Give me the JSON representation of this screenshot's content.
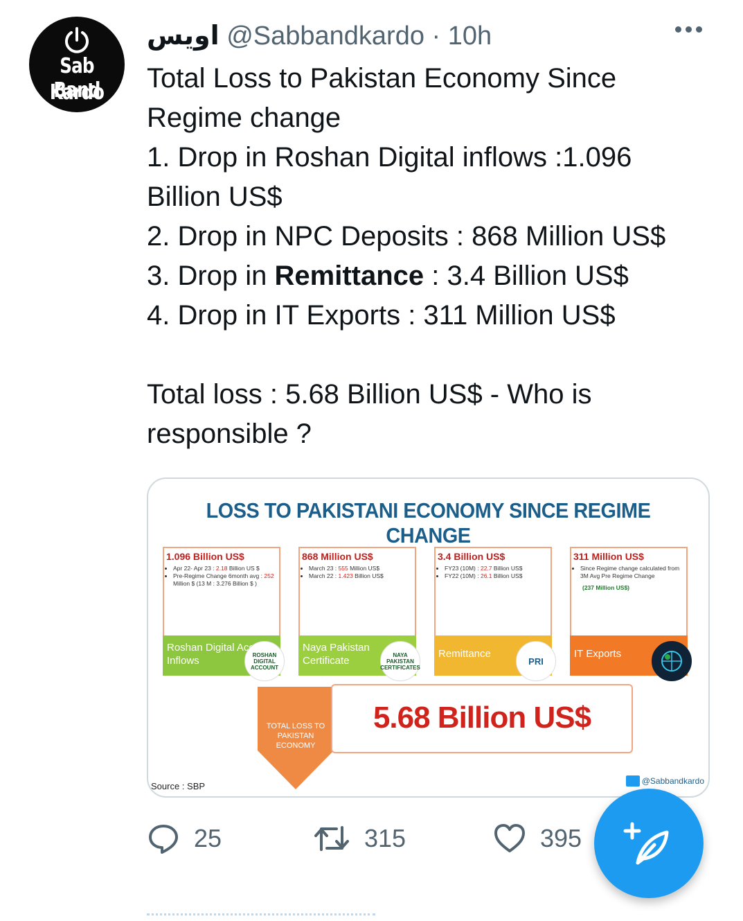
{
  "avatar": {
    "line1": "Sab Band",
    "line2": "Kardo",
    "icon": "power-icon"
  },
  "tweet": {
    "display_name": "اویس",
    "handle": "@Sabbandkardo",
    "separator": "·",
    "time": "10h",
    "lines": [
      "Total Loss to Pakistan Economy Since",
      "Regime change",
      "1. Drop in Roshan Digital inflows :1.096",
      "Billion US$",
      "2. Drop in NPC Deposits : 868 Million US$"
    ],
    "line3_prefix": "3. Drop in ",
    "line3_bold": "Remittance",
    "line3_suffix": " : 3.4 Billion US$",
    "line4": "4. Drop in IT Exports : 311 Million US$",
    "total_line1": "Total loss : 5.68 Billion US$ - Who is",
    "total_line2": "responsible ?"
  },
  "infographic": {
    "title": "LOSS TO PAKISTANI ECONOMY SINCE REGIME CHANGE",
    "cards": [
      {
        "value": "1.096 Billion US$",
        "bullets": [
          "Apr 22- Apr 23 : ",
          "2.18",
          " Billion US $",
          "Pre-Regime Change 6month avg : ",
          "252",
          " Million $ (13 M : 3.276 Billion $ )"
        ],
        "label": "Roshan Digital Account Inflows",
        "badge": "ROSHAN DIGITAL ACCOUNT",
        "band_color": "#8dc63f"
      },
      {
        "value": "868 Million US$",
        "bullets": [
          "March 23 : ",
          "555",
          " Million US$",
          "March 22 : ",
          "1.423",
          " Billion US$"
        ],
        "label": "Naya Pakistan Certificate",
        "badge": "NAYA PAKISTAN CERTIFICATES",
        "band_color": "#9ccf3f"
      },
      {
        "value": "3.4 Billion US$",
        "bullets": [
          "FY23 (10M) : ",
          "22.7",
          " Billion US$",
          "FY22 (10M) : ",
          "26.1",
          " Billion US$"
        ],
        "label": "Remittance",
        "badge": "PRI",
        "band_color": "#f2b731"
      },
      {
        "value": "311 Million US$",
        "bullets": [
          "Since Regime change calculated from 3M Avg Pre Regime Change",
          "(237 Million US$)"
        ],
        "label": "IT Exports",
        "badge": "",
        "band_color": "#f27a26"
      }
    ],
    "total_label": "TOTAL LOSS TO PAKISTAN ECONOMY",
    "total_value": "5.68 Billion US$",
    "source": "Source : SBP",
    "handle": "@Sabbandkardo"
  },
  "actions": {
    "replies": "25",
    "retweets": "315",
    "likes": "395"
  },
  "colors": {
    "accent": "#1d9bf0",
    "muted": "#536471",
    "title_blue": "#1c5e8a",
    "value_red": "#c0201c"
  }
}
